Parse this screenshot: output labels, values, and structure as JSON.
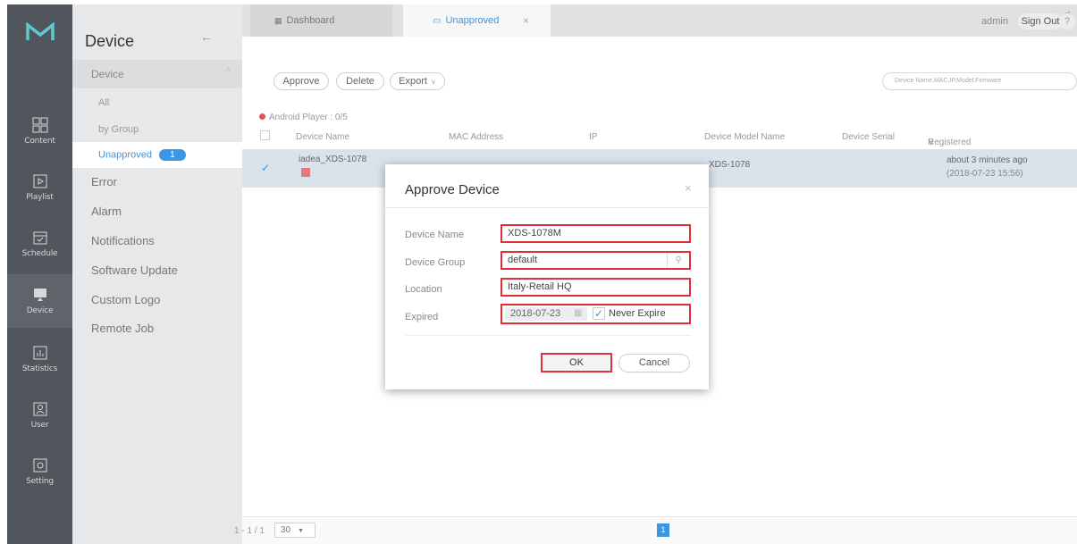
{
  "rail": {
    "items": [
      {
        "label": "Content",
        "icon": "content-icon"
      },
      {
        "label": "Playlist",
        "icon": "playlist-icon"
      },
      {
        "label": "Schedule",
        "icon": "schedule-icon"
      },
      {
        "label": "Device",
        "icon": "device-icon"
      },
      {
        "label": "Statistics",
        "icon": "statistics-icon"
      },
      {
        "label": "User",
        "icon": "user-icon"
      },
      {
        "label": "Setting",
        "icon": "setting-icon"
      }
    ]
  },
  "sidebar": {
    "title": "Device",
    "back": "←",
    "section": "Device",
    "sub_all": "All",
    "sub_group": "by Group",
    "sub_unapproved": "Unapproved",
    "unapproved_count": "1",
    "items": [
      "Error",
      "Alarm",
      "Notifications",
      "Software Update",
      "Custom Logo",
      "Remote Job"
    ]
  },
  "header": {
    "tab_dashboard": "Dashboard",
    "tab_unapproved": "Unapproved",
    "tab_close": "×",
    "user": "admin",
    "signout": "Sign Out",
    "help": "?"
  },
  "toolbar": {
    "approve": "Approve",
    "delete": "Delete",
    "export": "Export",
    "search_placeholder": "Device Name,MAC,IP,Model,Firmware"
  },
  "group_label": "Android Player : 0/5",
  "table": {
    "columns": [
      "Device Name",
      "MAC Address",
      "IP",
      "Device Model Name",
      "Device Serial",
      "Registered"
    ],
    "row": {
      "name": "iadea_XDS-1078",
      "model": "XDS-1078",
      "registered": "about 3 minutes ago",
      "registered_time": "(2018-07-23 15:56)"
    }
  },
  "footer": {
    "pageinfo": "1 - 1 / 1",
    "perpage": "30",
    "page": "1"
  },
  "modal": {
    "title": "Approve Device",
    "close": "×",
    "device_name_label": "Device Name",
    "device_name_value": "XDS-1078M",
    "device_group_label": "Device Group",
    "device_group_value": "default",
    "location_label": "Location",
    "location_value": "Italy-Retail HQ",
    "expired_label": "Expired",
    "expired_date": "2018-07-23",
    "never_expire": "Never Expire",
    "ok": "OK",
    "cancel": "Cancel"
  },
  "colors": {
    "accent": "#3b97e3",
    "highlight": "#e0303c",
    "rail": "#50565c"
  }
}
